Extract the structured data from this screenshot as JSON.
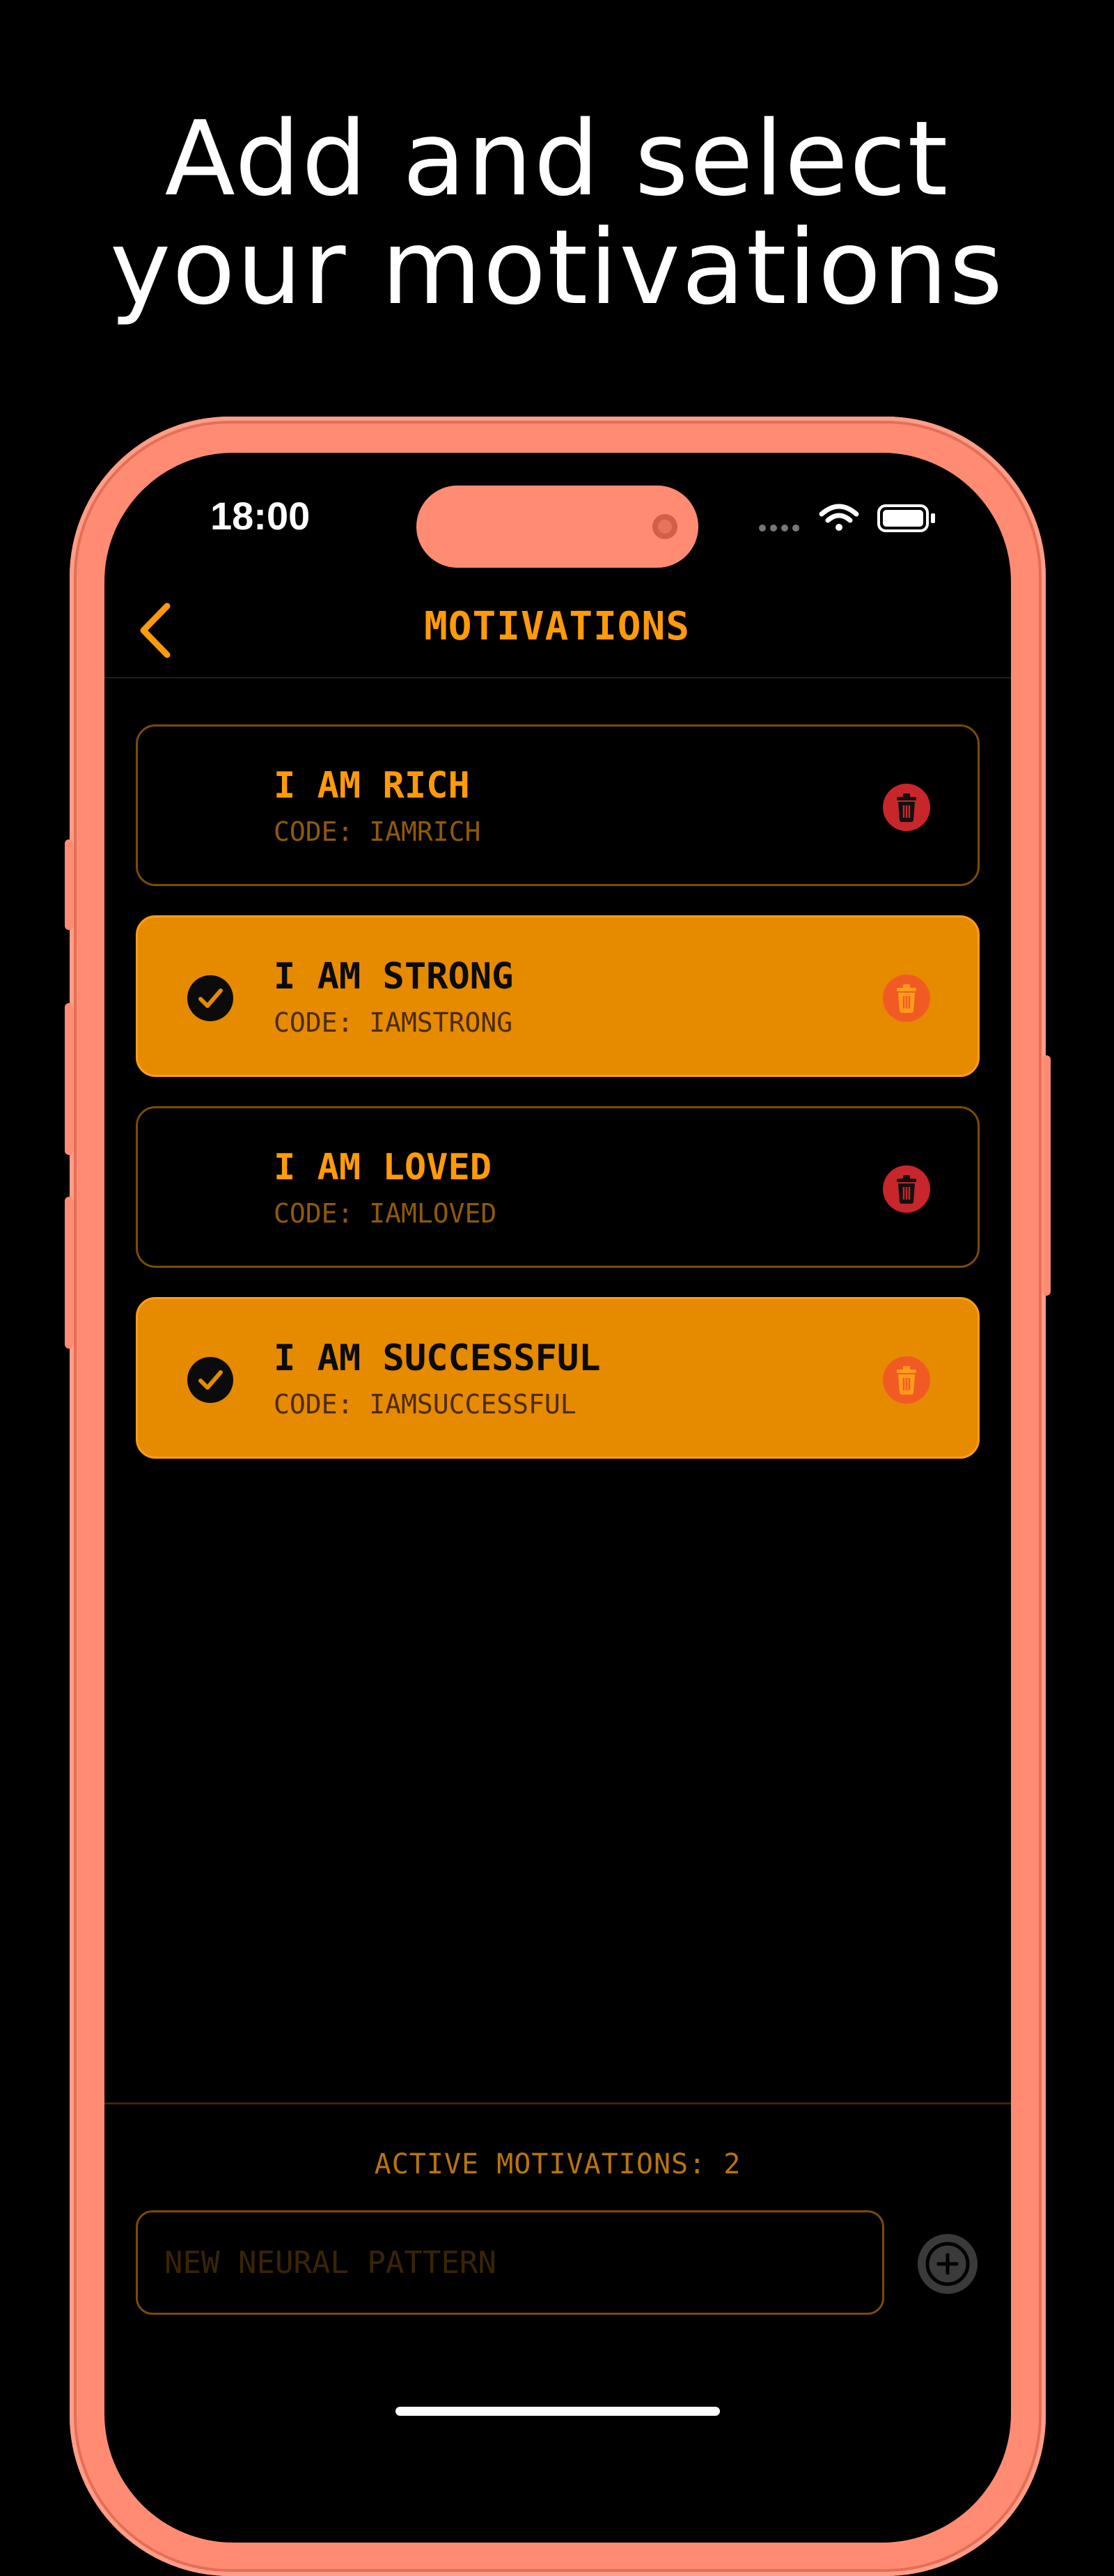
{
  "headline": {
    "line1": "Add and select",
    "line2": "your motivations"
  },
  "status_bar": {
    "time": "18:00"
  },
  "nav": {
    "title": "MOTIVATIONS"
  },
  "motivations": [
    {
      "title": "I AM RICH",
      "code": "CODE: IAMRICH",
      "selected": false
    },
    {
      "title": "I AM STRONG",
      "code": "CODE: IAMSTRONG",
      "selected": true
    },
    {
      "title": "I AM LOVED",
      "code": "CODE: IAMLOVED",
      "selected": false
    },
    {
      "title": "I AM SUCCESSFUL",
      "code": "CODE: IAMSUCCESSFUL",
      "selected": true
    }
  ],
  "footer": {
    "active_label": "ACTIVE MOTIVATIONS: 2",
    "input_placeholder": "NEW NEURAL PATTERN",
    "input_value": ""
  },
  "icons": {
    "back": "chevron-left-icon",
    "check": "checkmark-circle-icon",
    "delete": "trash-icon",
    "add": "plus-circle-icon"
  },
  "colors": {
    "accent": "#ff9a0a",
    "selected_card": "#e68a00",
    "phone_frame": "#ff8c72",
    "delete_red": "#c7262b",
    "background": "#000000"
  }
}
